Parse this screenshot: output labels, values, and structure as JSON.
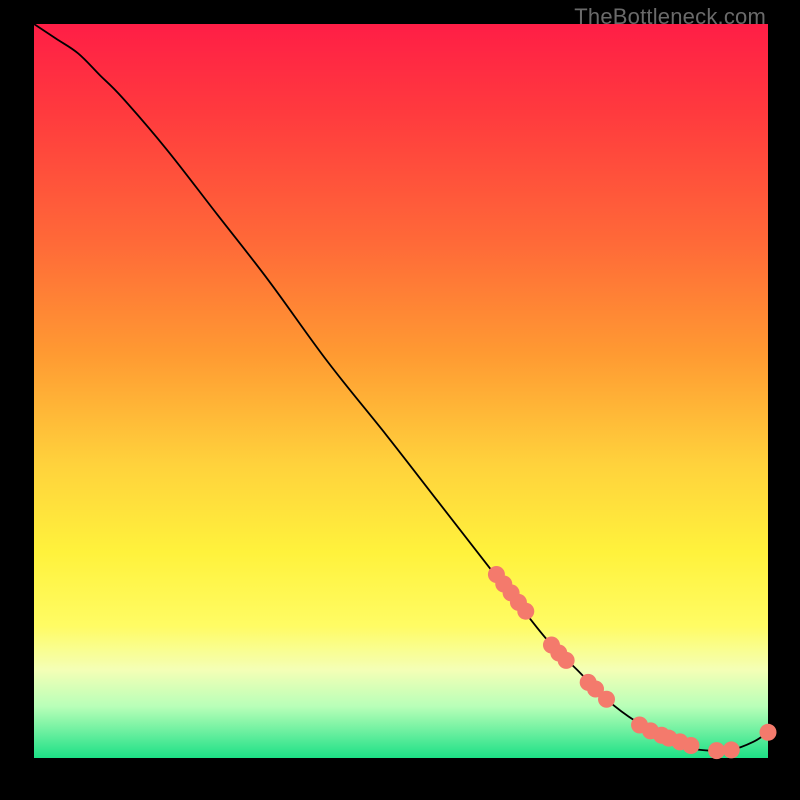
{
  "watermark": "TheBottleneck.com",
  "colors": {
    "curve": "#000000",
    "dot_fill": "#f47a6c",
    "dot_stroke": "#c15a50"
  },
  "chart_data": {
    "type": "line",
    "title": "",
    "xlabel": "",
    "ylabel": "",
    "xlim": [
      0,
      100
    ],
    "ylim": [
      0,
      100
    ],
    "series": [
      {
        "name": "curve",
        "x": [
          0,
          3,
          6,
          9,
          12,
          18,
          25,
          32,
          40,
          48,
          55,
          62,
          66,
          70,
          74,
          78,
          82,
          86,
          89,
          92,
          95,
          98,
          100
        ],
        "y": [
          100,
          98,
          96,
          93,
          90,
          83,
          74,
          65,
          54,
          44,
          35,
          26,
          21,
          16,
          12,
          8,
          5,
          3,
          1.5,
          1.0,
          1.1,
          2.2,
          3.5
        ]
      }
    ],
    "dots": {
      "name": "highlighted-points",
      "x": [
        63.0,
        64.0,
        65.0,
        66.0,
        67.0,
        70.5,
        71.5,
        72.5,
        75.5,
        76.5,
        78.0,
        82.5,
        84.0,
        85.5,
        86.5,
        88.0,
        89.5,
        93.0,
        95.0,
        100.0
      ],
      "y": [
        25.0,
        23.7,
        22.5,
        21.2,
        20.0,
        15.4,
        14.3,
        13.3,
        10.3,
        9.4,
        8.0,
        4.5,
        3.7,
        3.1,
        2.7,
        2.2,
        1.7,
        1.0,
        1.1,
        3.5
      ]
    }
  }
}
